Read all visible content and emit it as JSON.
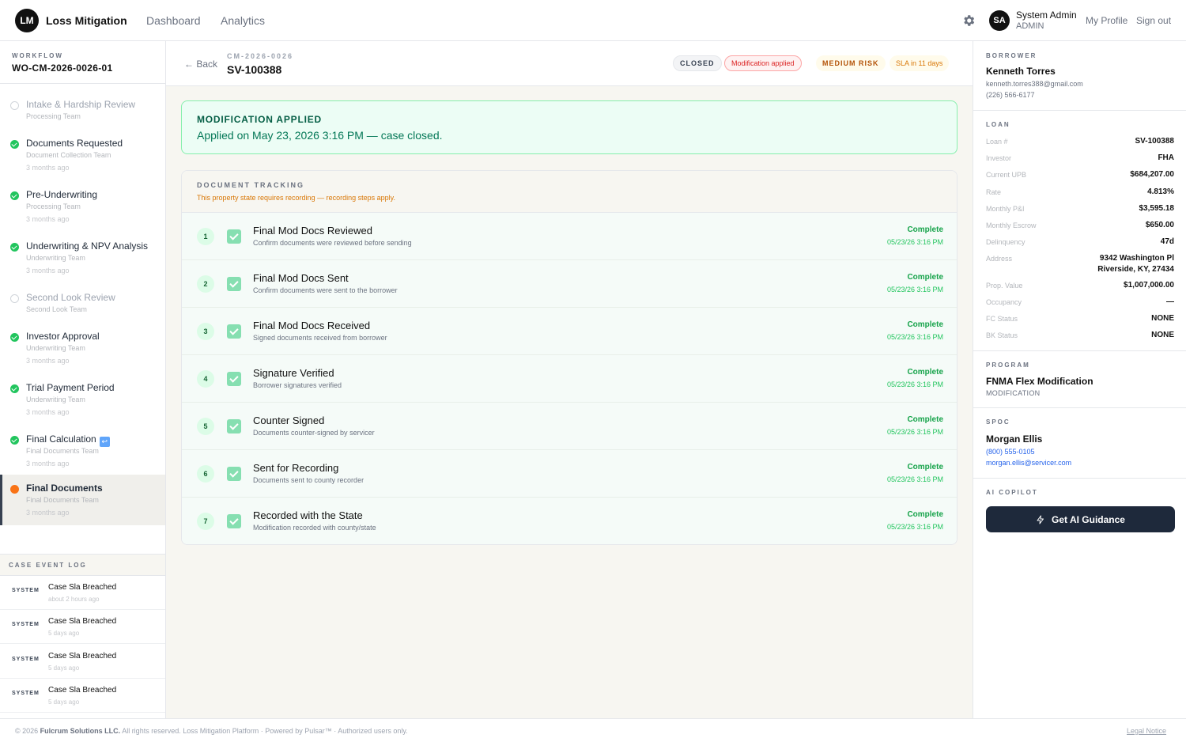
{
  "nav": {
    "logo_initials": "LM",
    "app_name": "Loss Mitigation",
    "links": [
      "Dashboard",
      "Analytics"
    ],
    "user": {
      "initials": "SA",
      "name": "System Admin",
      "role": "ADMIN"
    },
    "my_profile": "My Profile",
    "sign_out": "Sign out"
  },
  "workflow": {
    "label": "WORKFLOW",
    "id": "WO-CM-2026-0026-01",
    "steps": [
      {
        "title": "Intake & Hardship Review",
        "team": "Processing Team",
        "time": "",
        "status": "pending"
      },
      {
        "title": "Documents Requested",
        "team": "Document Collection Team",
        "time": "3 months ago",
        "status": "done"
      },
      {
        "title": "Pre-Underwriting",
        "team": "Processing Team",
        "time": "3 months ago",
        "status": "done"
      },
      {
        "title": "Underwriting & NPV Analysis",
        "team": "Underwriting Team",
        "time": "3 months ago",
        "status": "done"
      },
      {
        "title": "Second Look Review",
        "team": "Second Look Team",
        "time": "",
        "status": "pending"
      },
      {
        "title": "Investor Approval",
        "team": "Underwriting Team",
        "time": "3 months ago",
        "status": "done"
      },
      {
        "title": "Trial Payment Period",
        "team": "Underwriting Team",
        "time": "3 months ago",
        "status": "done"
      },
      {
        "title": "Final Calculation",
        "team": "Final Documents Team",
        "time": "3 months ago",
        "status": "done"
      },
      {
        "title": "Final Documents",
        "team": "Final Documents Team",
        "time": "3 months ago",
        "status": "current"
      }
    ]
  },
  "event_log": {
    "label": "CASE EVENT LOG",
    "events": [
      {
        "who": "SYSTEM",
        "what": "Case Sla Breached",
        "when": "about 2 hours ago"
      },
      {
        "who": "SYSTEM",
        "what": "Case Sla Breached",
        "when": "5 days ago"
      },
      {
        "who": "SYSTEM",
        "what": "Case Sla Breached",
        "when": "5 days ago"
      },
      {
        "who": "SYSTEM",
        "what": "Case Sla Breached",
        "when": "5 days ago"
      }
    ]
  },
  "case": {
    "back": "← Back",
    "code": "CM-2026-0026",
    "loan_id": "SV-100388",
    "badges": {
      "closed": "CLOSED",
      "mod": "Modification applied",
      "risk": "MEDIUM RISK",
      "sla": "SLA in 11 days"
    }
  },
  "banner": {
    "title": "MODIFICATION APPLIED",
    "text": "Applied on May 23, 2026 3:16 PM — case closed."
  },
  "tracking": {
    "title": "DOCUMENT TRACKING",
    "note": "This property state requires recording — recording steps apply.",
    "docs": [
      {
        "n": "1",
        "title": "Final Mod Docs Reviewed",
        "desc": "Confirm documents were reviewed before sending",
        "status": "Complete",
        "time": "05/23/26 3:16 PM"
      },
      {
        "n": "2",
        "title": "Final Mod Docs Sent",
        "desc": "Confirm documents were sent to the borrower",
        "status": "Complete",
        "time": "05/23/26 3:16 PM"
      },
      {
        "n": "3",
        "title": "Final Mod Docs Received",
        "desc": "Signed documents received from borrower",
        "status": "Complete",
        "time": "05/23/26 3:16 PM"
      },
      {
        "n": "4",
        "title": "Signature Verified",
        "desc": "Borrower signatures verified",
        "status": "Complete",
        "time": "05/23/26 3:16 PM"
      },
      {
        "n": "5",
        "title": "Counter Signed",
        "desc": "Documents counter-signed by servicer",
        "status": "Complete",
        "time": "05/23/26 3:16 PM"
      },
      {
        "n": "6",
        "title": "Sent for Recording",
        "desc": "Documents sent to county recorder",
        "status": "Complete",
        "time": "05/23/26 3:16 PM"
      },
      {
        "n": "7",
        "title": "Recorded with the State",
        "desc": "Modification recorded with county/state",
        "status": "Complete",
        "time": "05/23/26 3:16 PM"
      }
    ]
  },
  "borrower": {
    "label": "BORROWER",
    "name": "Kenneth Torres",
    "email": "kenneth.torres388@gmail.com",
    "phone": "(226) 566-6177"
  },
  "loan": {
    "label": "LOAN",
    "fields": [
      {
        "k": "Loan #",
        "v": "SV-100388"
      },
      {
        "k": "Investor",
        "v": "FHA"
      },
      {
        "k": "Current UPB",
        "v": "$684,207.00"
      },
      {
        "k": "Rate",
        "v": "4.813%"
      },
      {
        "k": "Monthly P&I",
        "v": "$3,595.18"
      },
      {
        "k": "Monthly Escrow",
        "v": "$650.00"
      },
      {
        "k": "Delinquency",
        "v": "47d"
      },
      {
        "k": "Address",
        "v": "9342 Washington Pl",
        "v2": "Riverside, KY, 27434"
      },
      {
        "k": "Prop. Value",
        "v": "$1,007,000.00"
      },
      {
        "k": "Occupancy",
        "v": "—"
      },
      {
        "k": "FC Status",
        "v": "NONE"
      },
      {
        "k": "BK Status",
        "v": "NONE"
      }
    ]
  },
  "program": {
    "label": "PROGRAM",
    "name": "FNMA Flex Modification",
    "type": "MODIFICATION"
  },
  "spoc": {
    "label": "SPOC",
    "name": "Morgan Ellis",
    "phone": "(800) 555-0105",
    "email": "morgan.ellis@servicer.com"
  },
  "copilot": {
    "label": "AI COPILOT",
    "button": "Get AI Guidance"
  },
  "footer": {
    "copyright_prefix": "© 2026",
    "company": "Fulcrum Solutions LLC.",
    "copyright_suffix": "All rights reserved. Loss Mitigation Platform · Powered by Pulsar™ · Authorized users only.",
    "legal": "Legal Notice"
  }
}
